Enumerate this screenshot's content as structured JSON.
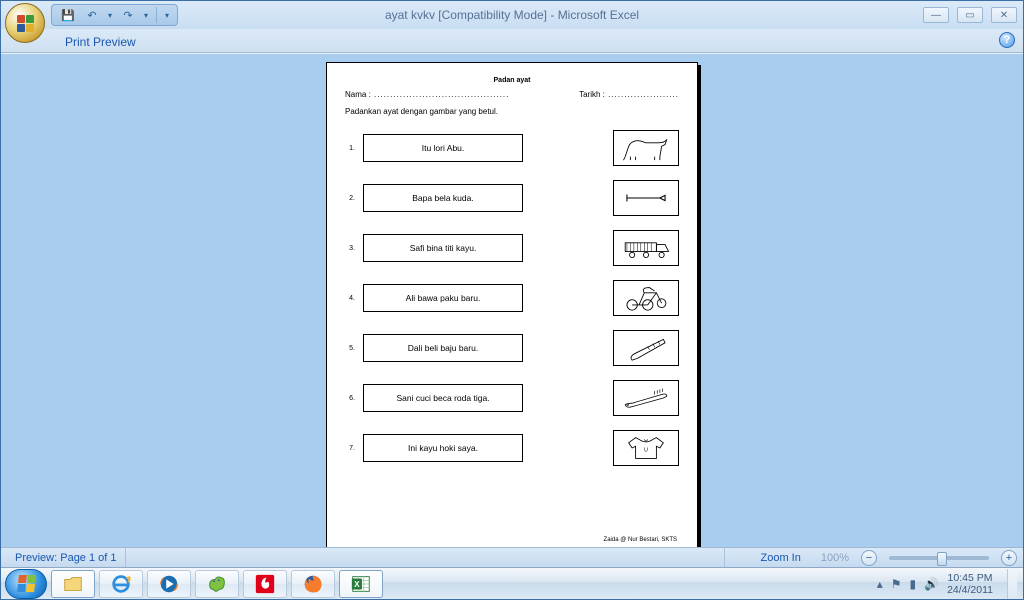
{
  "title": {
    "document": "ayat kvkv  [Compatibility Mode]",
    "app": "Microsoft Excel"
  },
  "ribbon": {
    "tab": "Print Preview"
  },
  "status": {
    "preview": "Preview: Page 1 of 1",
    "zoom_label": "Zoom In",
    "zoom_pct": "100%"
  },
  "worksheet": {
    "title": "Padan ayat",
    "nama_label": "Nama :",
    "tarikh_label": "Tarikh :",
    "instruction": "Padankan ayat dengan gambar yang betul.",
    "sentences": [
      "Itu lori Abu.",
      "Bapa bela kuda.",
      "Safi bina titi kayu.",
      "Ali bawa paku baru.",
      "Dali beli baju baru.",
      "Sani cuci beca roda tiga.",
      "Ini kayu hoki saya."
    ],
    "pictures": [
      "horse",
      "nail",
      "lorry",
      "trishaw",
      "hockey-stick",
      "toothbrush",
      "shirt"
    ],
    "credit": "Zaida @ Nur Bestari, SKTS"
  },
  "taskbar": {
    "buttons": [
      "explorer",
      "ie",
      "wmp",
      "msn",
      "vodafone",
      "firefox",
      "excel"
    ],
    "tray": {
      "time": "10:45 PM",
      "date": "24/4/2011"
    }
  }
}
